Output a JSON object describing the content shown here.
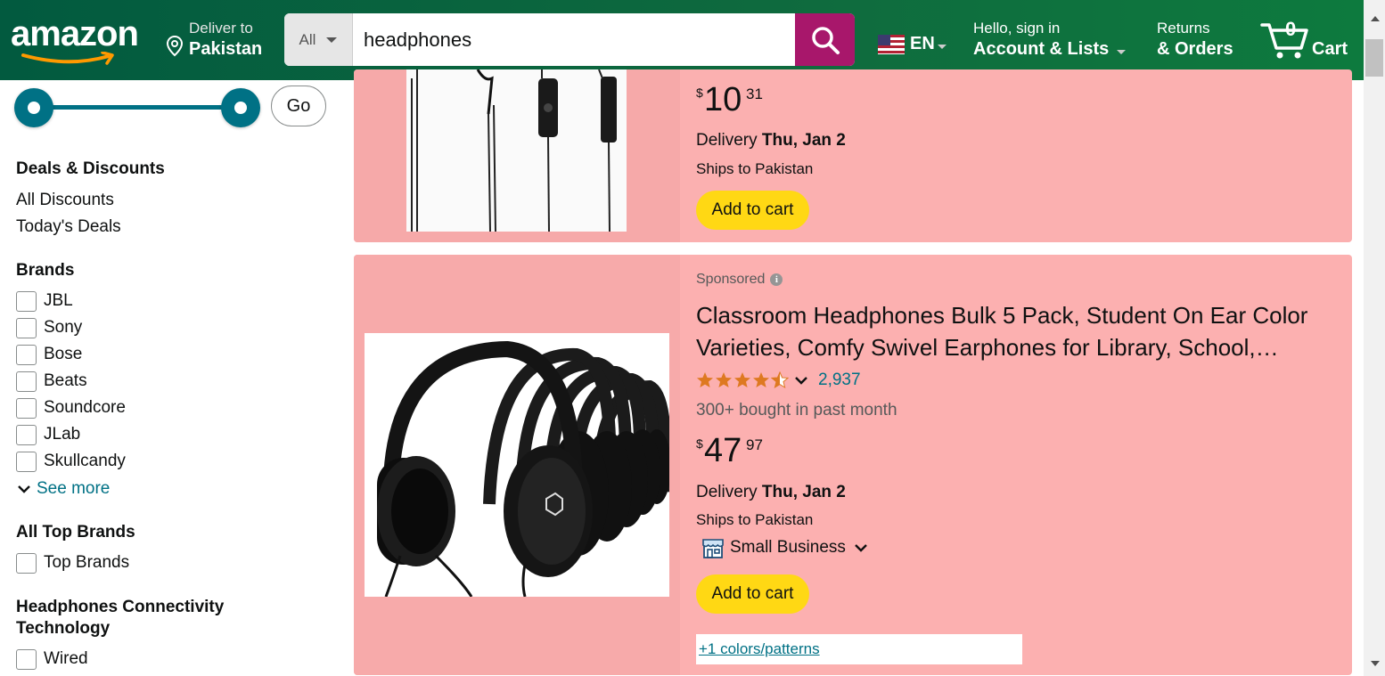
{
  "header": {
    "logo_text": "amazon",
    "deliver_label": "Deliver to",
    "deliver_location": "Pakistan",
    "search_category": "All",
    "search_value": "headphones",
    "language": "EN",
    "account_greeting": "Hello, sign in",
    "account_label": "Account & Lists",
    "returns_label": "Returns",
    "orders_label": "& Orders",
    "cart_count": "0",
    "cart_label": "Cart"
  },
  "sidebar": {
    "go_label": "Go",
    "deals": {
      "title": "Deals & Discounts",
      "links": [
        "All Discounts",
        "Today's Deals"
      ]
    },
    "brands": {
      "title": "Brands",
      "items": [
        "JBL",
        "Sony",
        "Bose",
        "Beats",
        "Soundcore",
        "JLab",
        "Skullcandy"
      ],
      "see_more": "See more"
    },
    "top_brands": {
      "title": "All Top Brands",
      "items": [
        "Top Brands"
      ]
    },
    "connectivity": {
      "title_line1": "Headphones Connectivity",
      "title_line2": "Technology",
      "items": [
        "Wired"
      ]
    }
  },
  "results": [
    {
      "price_symbol": "$",
      "price_whole": "10",
      "price_fraction": "31",
      "delivery_label": "Delivery",
      "delivery_date": "Thu, Jan 2",
      "ships_to": "Ships to Pakistan",
      "add_to_cart": "Add to cart"
    },
    {
      "sponsored": "Sponsored",
      "title": "Classroom Headphones Bulk 5 Pack, Student On Ear Color Varieties, Comfy Swivel Earphones for Library, School, Airplane, Travel",
      "rating": 4.5,
      "rating_count": "2,937",
      "bought": "300+ bought in past month",
      "price_symbol": "$",
      "price_whole": "47",
      "price_fraction": "97",
      "delivery_label": "Delivery",
      "delivery_date": "Thu, Jan 2",
      "ships_to": "Ships to Pakistan",
      "small_business": "Small Business",
      "add_to_cart": "Add to cart",
      "colors_link": "+1 colors/patterns"
    }
  ],
  "colors": {
    "header_bg": "#025a3f",
    "search_button": "#a8176b",
    "accent_teal": "#007185",
    "cart_button": "#ffd814",
    "card_bg": "#fcb0b0",
    "star": "#de7921"
  }
}
